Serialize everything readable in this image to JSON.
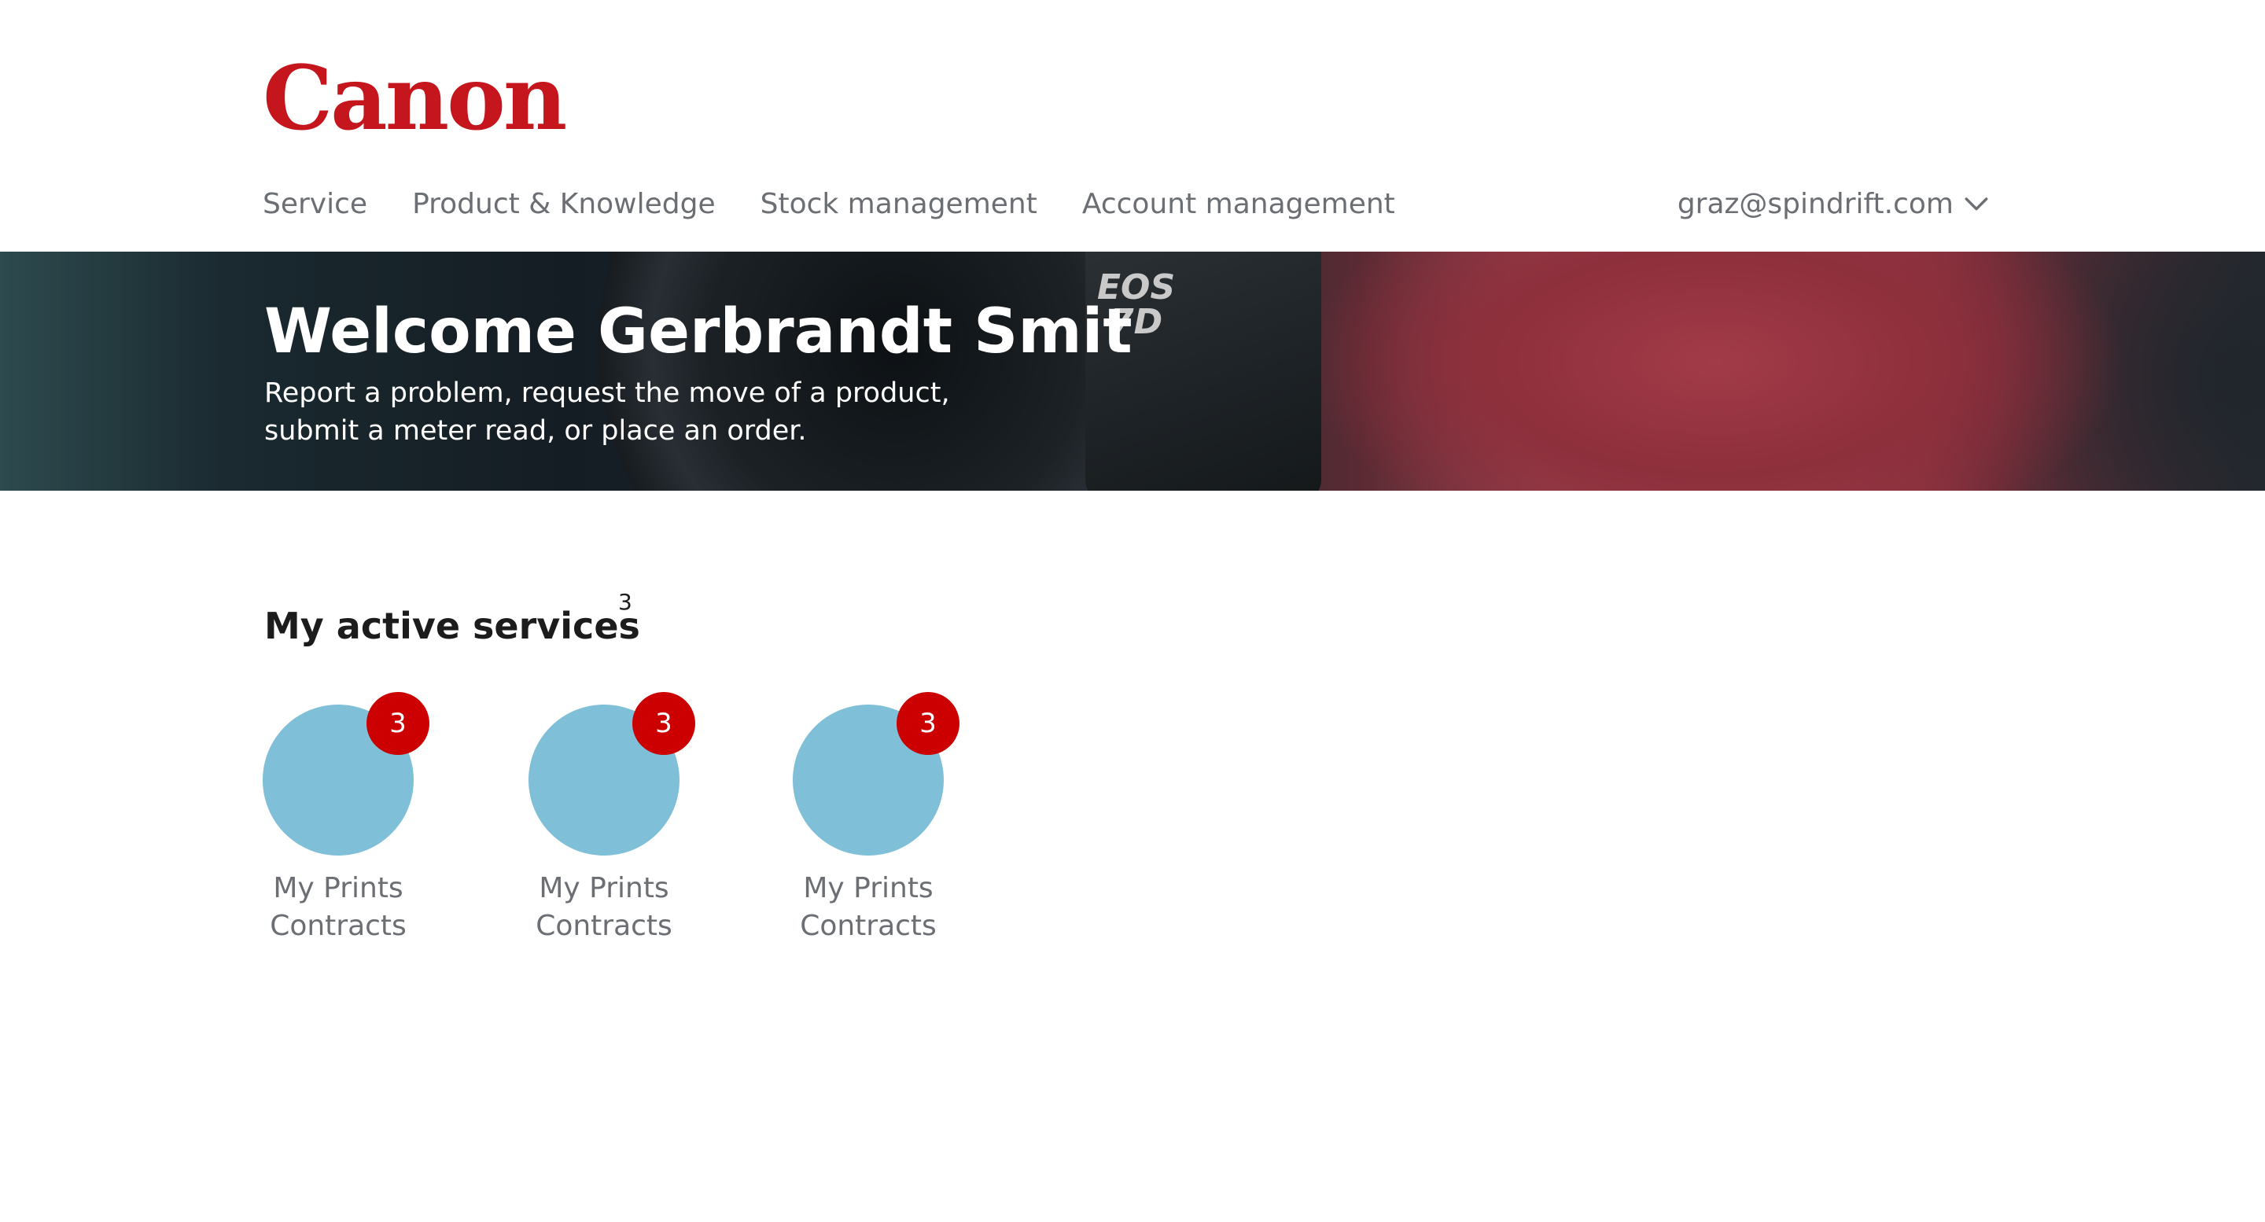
{
  "header": {
    "logo_text": "Canon",
    "nav": [
      {
        "label": "Service"
      },
      {
        "label": "Product & Knowledge"
      },
      {
        "label": "Stock management"
      },
      {
        "label": "Account management"
      }
    ],
    "user_email": "graz@spindrift.com"
  },
  "hero": {
    "camera_badge_line1": "EOS",
    "camera_badge_line2": "7D",
    "title": "Welcome Gerbrandt Smit",
    "subtitle_line1": "Report a problem, request the move of a product,",
    "subtitle_line2": "submit a meter read, or place an order."
  },
  "services": {
    "title": "My active services",
    "count": "3",
    "items": [
      {
        "label_line1": "My Prints",
        "label_line2": "Contracts",
        "badge": "3"
      },
      {
        "label_line1": "My Prints",
        "label_line2": "Contracts",
        "badge": "3"
      },
      {
        "label_line1": "My Prints",
        "label_line2": "Contracts",
        "badge": "3"
      }
    ]
  },
  "colors": {
    "brand_red": "#c4161c",
    "badge_red": "#cc0000",
    "service_circle": "#7fbfd7",
    "nav_text": "#6b6e73"
  }
}
